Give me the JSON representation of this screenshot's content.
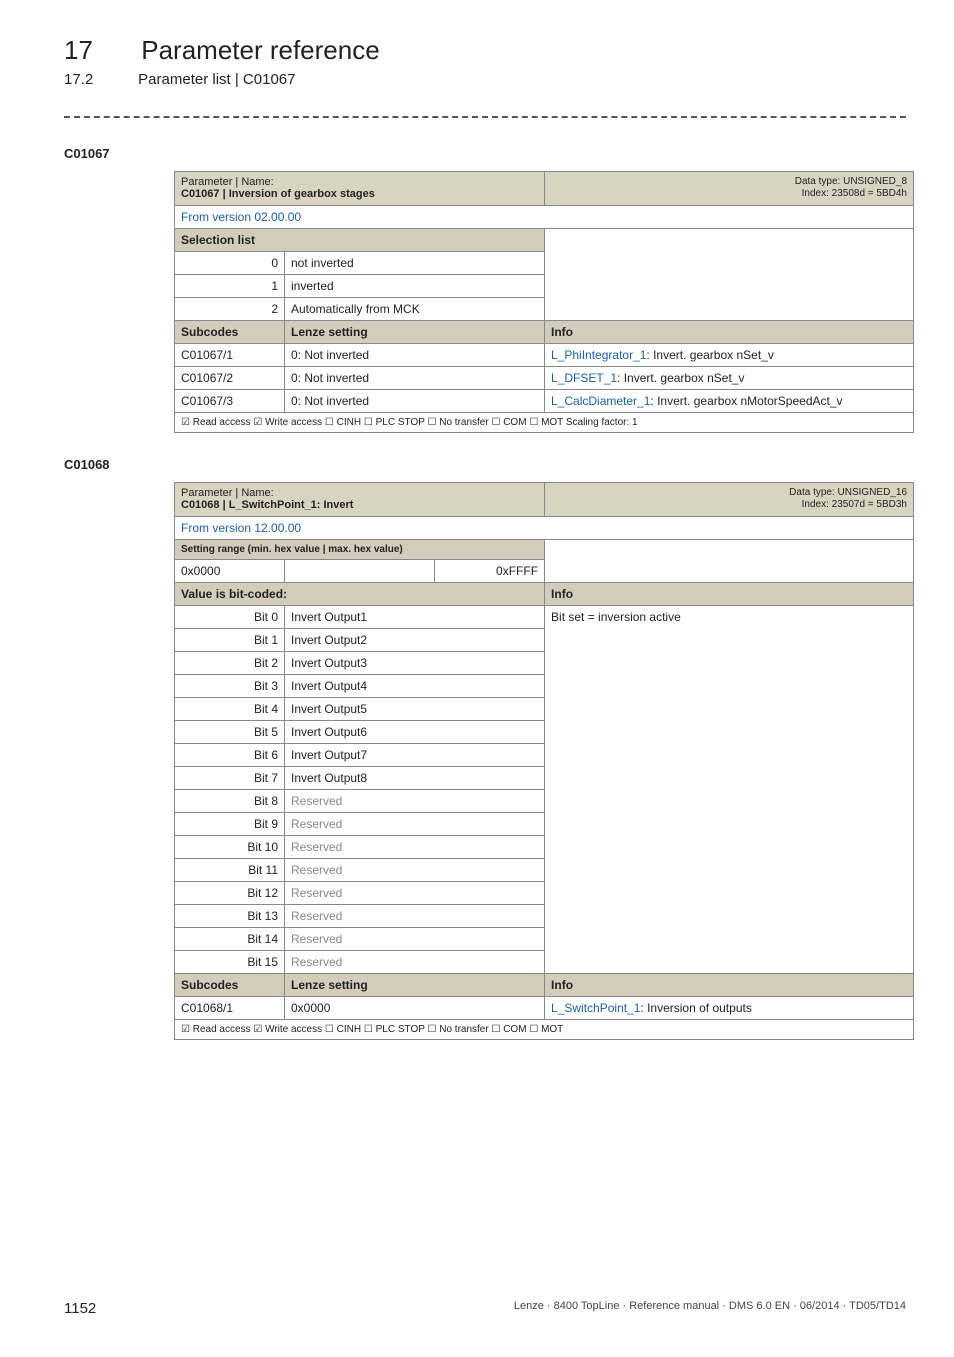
{
  "header": {
    "chap_num": "17",
    "chap_title": "Parameter reference",
    "sec_num": "17.2",
    "sec_title": "Parameter list | C01067"
  },
  "c01067": {
    "code_label": "C01067",
    "param_label": "Parameter | Name:",
    "param_name": "C01067 | Inversion of gearbox stages",
    "datatype": "Data type: UNSIGNED_8",
    "index": "Index: 23508d = 5BD4h",
    "version": "From version 02.00.00",
    "sel_list_label": "Selection list",
    "rows": [
      {
        "n": "0",
        "txt": "not inverted"
      },
      {
        "n": "1",
        "txt": "inverted"
      },
      {
        "n": "2",
        "txt": "Automatically from MCK"
      }
    ],
    "subcodes_hdr": {
      "a": "Subcodes",
      "b": "Lenze setting",
      "c": "Info"
    },
    "subs": [
      {
        "a": "C01067/1",
        "b": "0: Not inverted",
        "link": "L_PhiIntegrator_1",
        "after": ": Invert. gearbox nSet_v"
      },
      {
        "a": "C01067/2",
        "b": "0: Not inverted",
        "link": "L_DFSET_1",
        "after": ": Invert. gearbox nSet_v"
      },
      {
        "a": "C01067/3",
        "b": "0: Not inverted",
        "link": "L_CalcDiameter_1",
        "after": ": Invert. gearbox nMotorSpeedAct_v"
      }
    ],
    "footer": "☑ Read access   ☑ Write access   ☐ CINH   ☐ PLC STOP   ☐ No transfer   ☐ COM   ☐ MOT     Scaling factor: 1"
  },
  "c01068": {
    "code_label": "C01068",
    "param_label": "Parameter | Name:",
    "param_name": "C01068 | L_SwitchPoint_1: Invert",
    "datatype": "Data type: UNSIGNED_16",
    "index": "Index: 23507d = 5BD3h",
    "version": "From version 12.00.00",
    "range_label": "Setting range (min. hex value | max. hex value)",
    "range_min": "0x0000",
    "range_max": "0xFFFF",
    "bitcoded_label": "Value is bit-coded:",
    "info_label": "Info",
    "info_value": "Bit set = inversion active",
    "bits": [
      {
        "n": "Bit 0",
        "txt": "Invert Output1",
        "res": false
      },
      {
        "n": "Bit 1",
        "txt": "Invert Output2",
        "res": false
      },
      {
        "n": "Bit 2",
        "txt": "Invert Output3",
        "res": false
      },
      {
        "n": "Bit 3",
        "txt": "Invert Output4",
        "res": false
      },
      {
        "n": "Bit 4",
        "txt": "Invert Output5",
        "res": false
      },
      {
        "n": "Bit 5",
        "txt": "Invert Output6",
        "res": false
      },
      {
        "n": "Bit 6",
        "txt": "Invert Output7",
        "res": false
      },
      {
        "n": "Bit 7",
        "txt": "Invert Output8",
        "res": false
      },
      {
        "n": "Bit 8",
        "txt": "Reserved",
        "res": true
      },
      {
        "n": "Bit 9",
        "txt": "Reserved",
        "res": true
      },
      {
        "n": "Bit 10",
        "txt": "Reserved",
        "res": true
      },
      {
        "n": "Bit 11",
        "txt": "Reserved",
        "res": true
      },
      {
        "n": "Bit 12",
        "txt": "Reserved",
        "res": true
      },
      {
        "n": "Bit 13",
        "txt": "Reserved",
        "res": true
      },
      {
        "n": "Bit 14",
        "txt": "Reserved",
        "res": true
      },
      {
        "n": "Bit 15",
        "txt": "Reserved",
        "res": true
      }
    ],
    "subcodes_hdr": {
      "a": "Subcodes",
      "b": "Lenze setting",
      "c": "Info"
    },
    "sub": {
      "a": "C01068/1",
      "b": "0x0000",
      "link": "L_SwitchPoint_1",
      "after": ": Inversion of outputs"
    },
    "footer": "☑ Read access   ☑ Write access   ☐ CINH   ☐ PLC STOP   ☐ No transfer   ☐ COM   ☐ MOT"
  },
  "footer": {
    "page": "1152",
    "right": "Lenze · 8400 TopLine · Reference manual · DMS 6.0 EN · 06/2014 · TD05/TD14"
  }
}
